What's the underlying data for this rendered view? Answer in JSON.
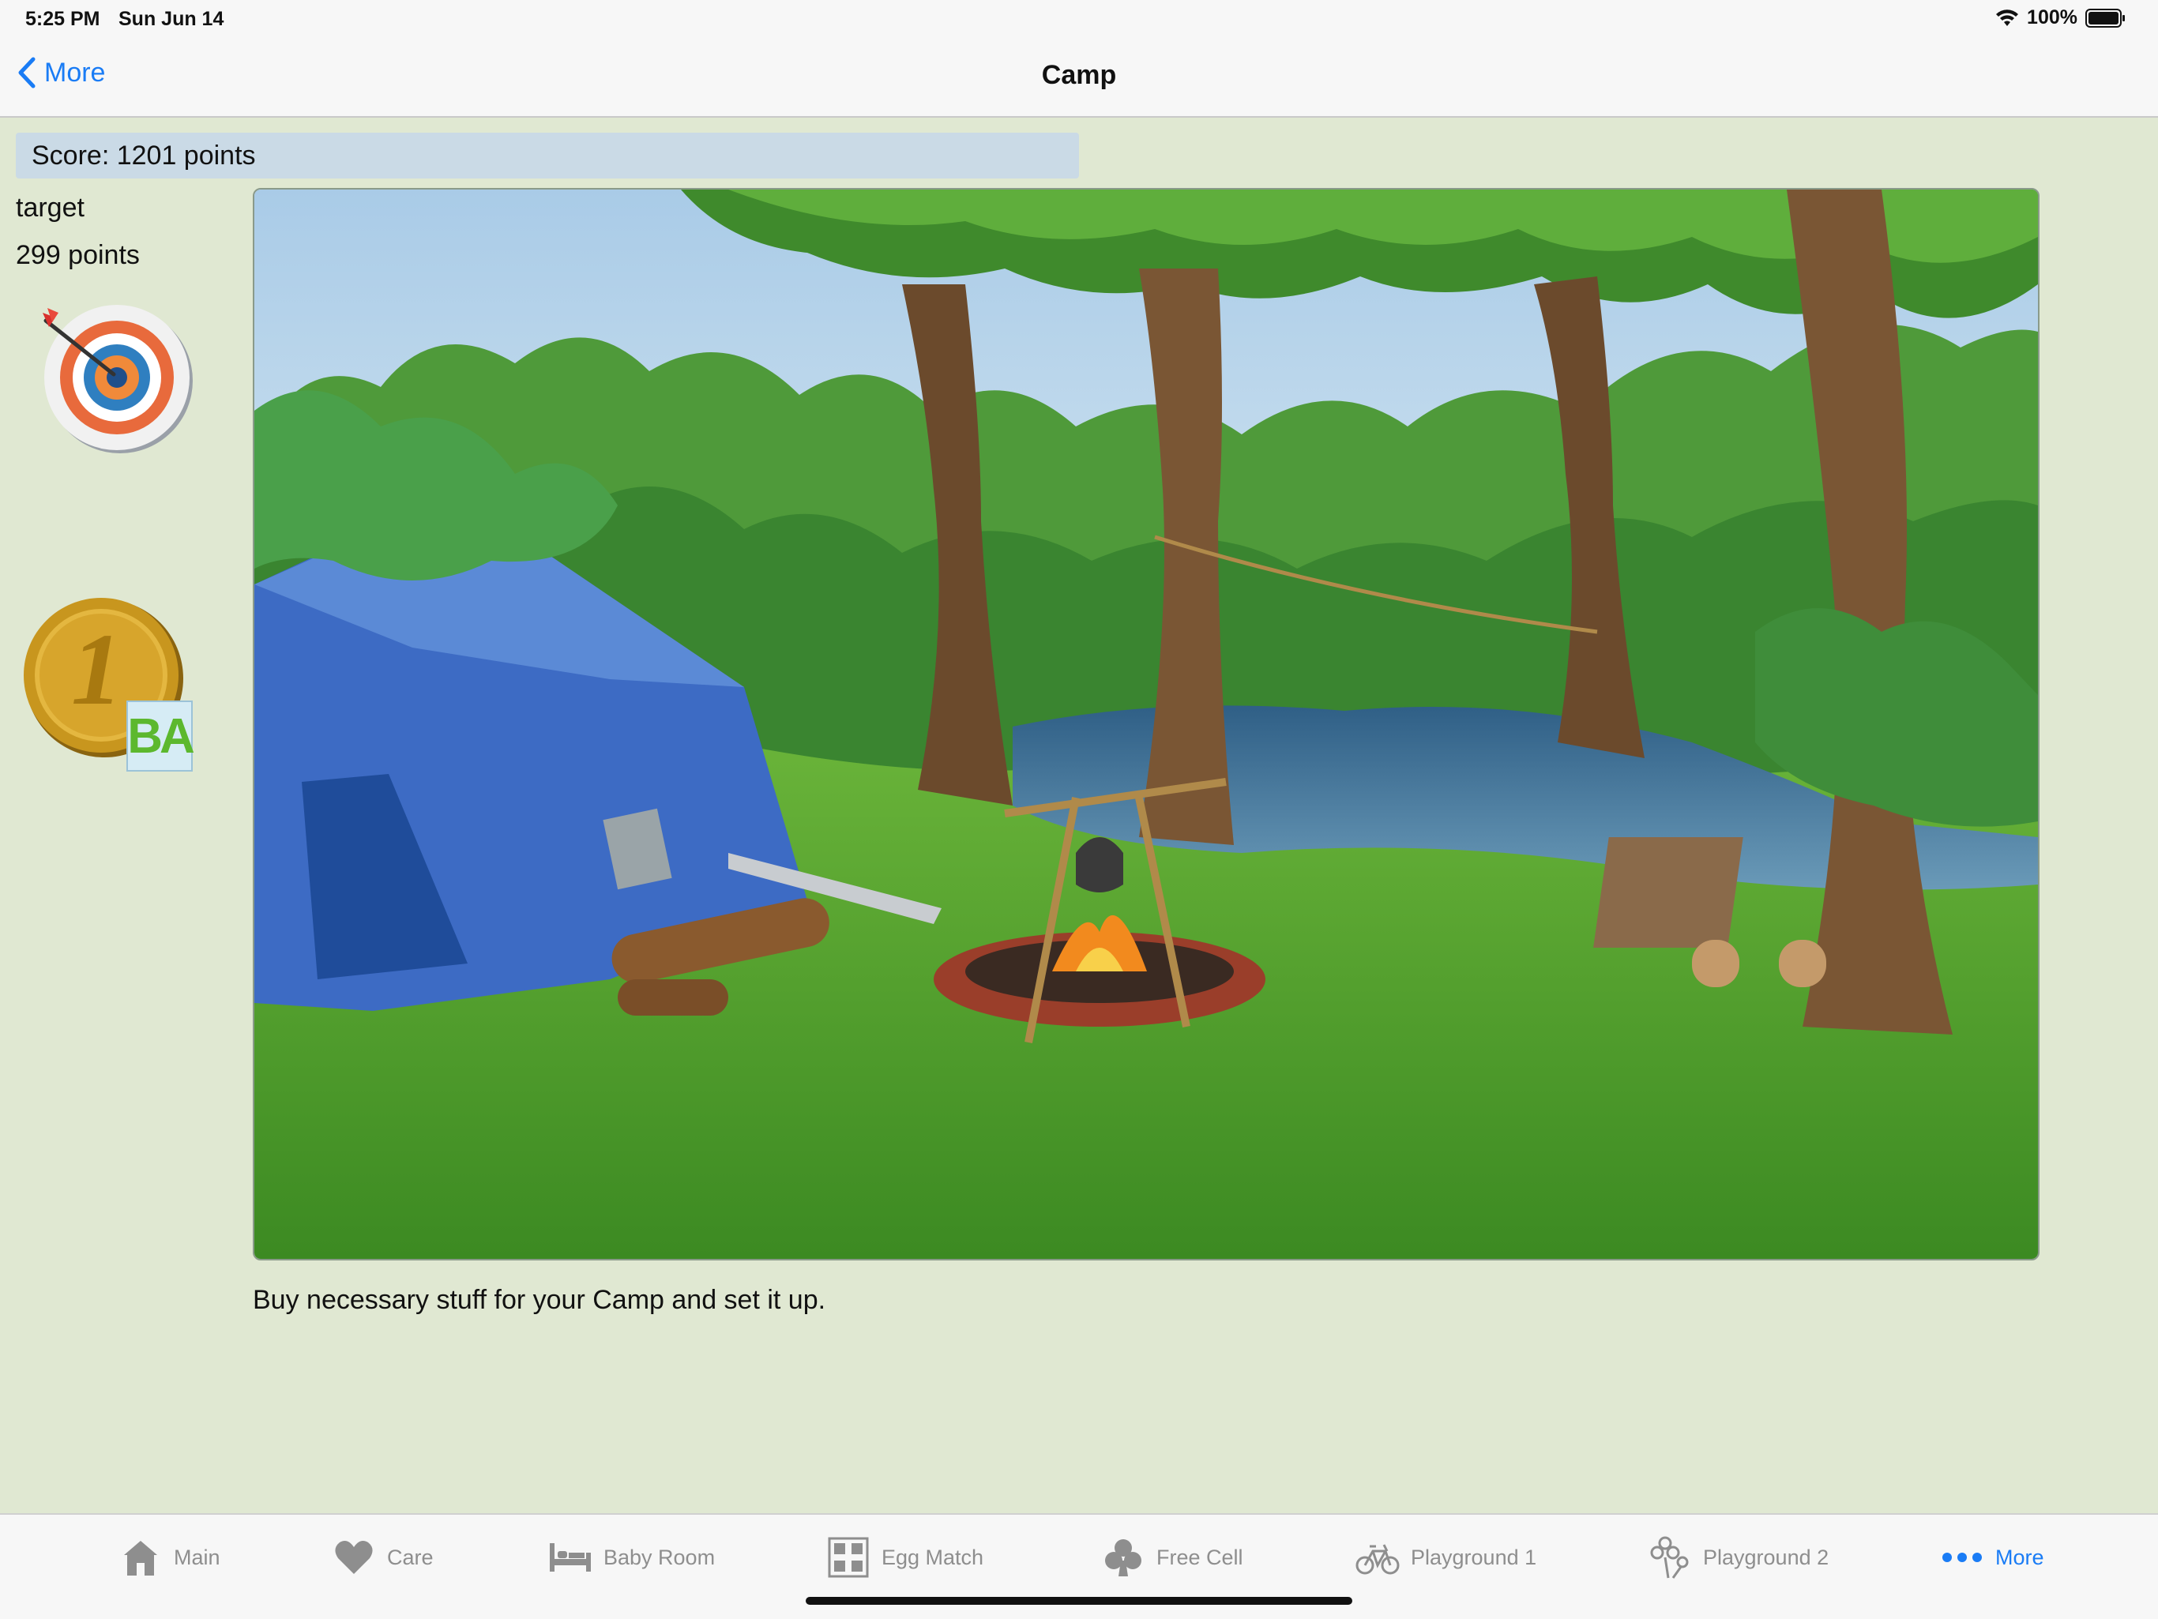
{
  "status_bar": {
    "time": "5:25 PM",
    "date": "Sun Jun 14",
    "battery": "100%"
  },
  "nav": {
    "back_label": "More",
    "title": "Camp"
  },
  "score": {
    "text": "Score: 1201 points"
  },
  "sidebar": {
    "target_label": "target",
    "target_points": "299 points",
    "coin_number": "1",
    "coin_badge": "BA"
  },
  "scene": {
    "description": "Buy necessary stuff for your Camp and set it up.",
    "colors": {
      "sky": "#b9d7ee",
      "grass": "#4e9a2c",
      "tent": "#3d6bc4",
      "water": "#3f6f9a"
    }
  },
  "tabs": [
    {
      "label": "Main",
      "icon": "house-icon",
      "active": false
    },
    {
      "label": "Care",
      "icon": "heart-icon",
      "active": false
    },
    {
      "label": "Baby Room",
      "icon": "bed-icon",
      "active": false
    },
    {
      "label": "Egg Match",
      "icon": "grid-icon",
      "active": false
    },
    {
      "label": "Free Cell",
      "icon": "club-icon",
      "active": false
    },
    {
      "label": "Playground 1",
      "icon": "bicycle-icon",
      "active": false
    },
    {
      "label": "Playground 2",
      "icon": "flower-icon",
      "active": false
    },
    {
      "label": "More",
      "icon": "ellipsis-icon",
      "active": true
    }
  ],
  "theme": {
    "accent": "#1a7cf5",
    "background": "#e0e8d2",
    "score_bar": "#cadae6"
  }
}
